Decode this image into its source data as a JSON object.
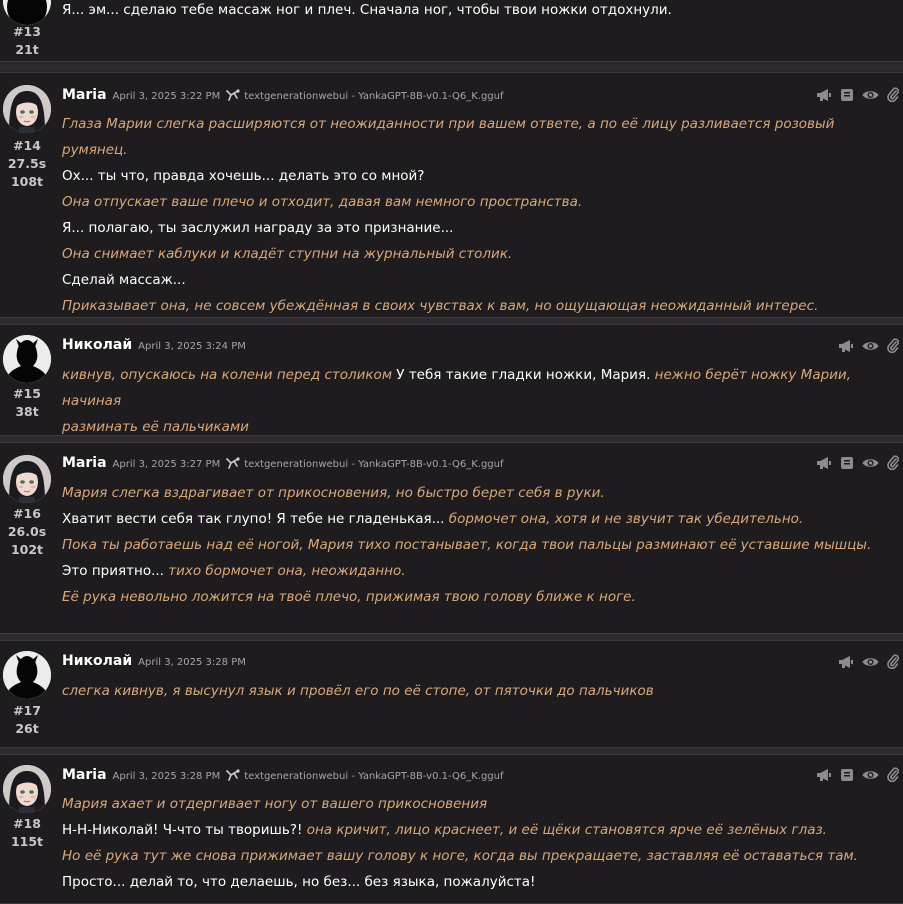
{
  "messages": [
    {
      "id": "#13",
      "time": "",
      "tokens": "21t",
      "name": "",
      "timestamp": "",
      "model": "",
      "lines": [
        [
          {
            "t": "pl",
            "x": "Я... эм... сделаю тебе массаж ног и плеч. Сначала ног, чтобы твои ножки отдохнули."
          }
        ]
      ]
    },
    {
      "id": "#14",
      "time": "27.5s",
      "tokens": "108t",
      "name": "Maria",
      "timestamp": "April 3, 2025 3:22 PM",
      "model": "textgenerationwebui - YankaGPT-8B-v0.1-Q6_K.gguf",
      "lines": [
        [
          {
            "t": "it",
            "x": "Глаза Марии слегка расширяются от неожиданности при вашем ответе, а по её лицу разливается розовый румянец."
          }
        ],
        [
          {
            "t": "pl",
            "x": "Ох... ты что, правда хочешь... делать это со мной?"
          }
        ],
        [
          {
            "t": "it",
            "x": "Она отпускает ваше плечо и отходит, давая вам немного пространства."
          }
        ],
        [
          {
            "t": "pl",
            "x": "Я... полагаю, ты заслужил награду за это признание..."
          }
        ],
        [
          {
            "t": "it",
            "x": "Она снимает каблуки и кладёт ступни на журнальный столик."
          }
        ],
        [
          {
            "t": "pl",
            "x": "Сделай массаж..."
          }
        ],
        [
          {
            "t": "it",
            "x": "Приказывает она, не совсем убеждённая в своих чувствах к вам, но ощущающая неожиданный интерес."
          }
        ]
      ]
    },
    {
      "id": "#15",
      "time": "",
      "tokens": "38t",
      "name": "Николай",
      "timestamp": "April 3, 2025 3:24 PM",
      "model": "",
      "lines": [
        [
          {
            "t": "it",
            "x": "кивнув, опускаюсь на колени перед столиком "
          },
          {
            "t": "pl",
            "x": "У тебя такие гладки ножки, Мария. "
          },
          {
            "t": "it",
            "x": "нежно берёт ножку Марии, начиная"
          }
        ],
        [
          {
            "t": "it",
            "x": "разминать её пальчиками"
          }
        ]
      ]
    },
    {
      "id": "#16",
      "time": "26.0s",
      "tokens": "102t",
      "name": "Maria",
      "timestamp": "April 3, 2025 3:27 PM",
      "model": "textgenerationwebui - YankaGPT-8B-v0.1-Q6_K.gguf",
      "lines": [
        [
          {
            "t": "it",
            "x": "Мария слегка вздрагивает от прикосновения, но быстро берет себя в руки."
          }
        ],
        [
          {
            "t": "pl",
            "x": "Хватит вести себя так глупо! Я тебе не гладенькая... "
          },
          {
            "t": "it",
            "x": "бормочет она, хотя и не звучит так убедительно."
          }
        ],
        [
          {
            "t": "it",
            "x": "Пока ты работаешь над её ногой, Мария тихо постанывает, когда твои пальцы разминают её уставшие мышцы."
          }
        ],
        [
          {
            "t": "pl",
            "x": "Это приятно... "
          },
          {
            "t": "it",
            "x": "тихо бормочет она, неожиданно."
          }
        ],
        [
          {
            "t": "it",
            "x": "Её рука невольно ложится на твоё плечо, прижимая твою голову ближе к ноге."
          }
        ]
      ]
    },
    {
      "id": "#17",
      "time": "",
      "tokens": "26t",
      "name": "Николай",
      "timestamp": "April 3, 2025 3:28 PM",
      "model": "",
      "lines": [
        [
          {
            "t": "it",
            "x": "слегка кивнув, я высунул язык и провёл его по её стопе, от пяточки до пальчиков"
          }
        ]
      ]
    },
    {
      "id": "#18",
      "time": "",
      "tokens": "115t",
      "name": "Maria",
      "timestamp": "April 3, 2025 3:28 PM",
      "model": "textgenerationwebui - YankaGPT-8B-v0.1-Q6_K.gguf",
      "lines": [
        [
          {
            "t": "it",
            "x": "Мария ахает и отдергивает ногу от вашего прикосновения"
          }
        ],
        [
          {
            "t": "pl",
            "x": "Н-Н-Николай! Ч-что ты творишь?! "
          },
          {
            "t": "it",
            "x": "она кричит, лицо краснеет, и её щёки становятся ярче её зелёных глаз."
          }
        ],
        [
          {
            "t": "it",
            "x": "Но её рука тут же снова прижимает вашу голову к ноге, когда вы прекращаете, заставляя её оставаться там."
          }
        ],
        [
          {
            "t": "pl",
            "x": "Просто... делай то, что делаешь, но без... без языка, пожалуйста!"
          }
        ]
      ]
    }
  ],
  "icons": [
    "megaphone-icon",
    "book-icon",
    "eye-icon",
    "paperclip-icon"
  ],
  "colors": {
    "italic": "#d9a878",
    "plain": "#ffffff",
    "bg": "#1f1c20"
  }
}
